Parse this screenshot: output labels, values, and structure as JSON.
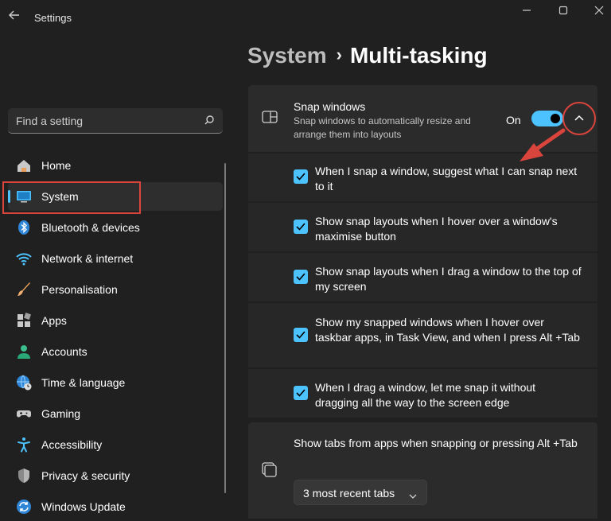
{
  "window": {
    "title": "Settings",
    "icons": {
      "back": "back-arrow-icon",
      "minimize": "minimize-icon",
      "maximize": "maximize-icon",
      "close": "close-icon"
    }
  },
  "breadcrumb": {
    "parent": "System",
    "separator": "›",
    "current": "Multi-tasking"
  },
  "search": {
    "placeholder": "Find a setting",
    "icon": "search-icon"
  },
  "nav": {
    "items": [
      {
        "label": "Home",
        "icon": "home-icon"
      },
      {
        "label": "System",
        "icon": "monitor-icon",
        "active": true
      },
      {
        "label": "Bluetooth & devices",
        "icon": "bluetooth-icon"
      },
      {
        "label": "Network & internet",
        "icon": "wifi-icon"
      },
      {
        "label": "Personalisation",
        "icon": "brush-icon"
      },
      {
        "label": "Apps",
        "icon": "apps-icon"
      },
      {
        "label": "Accounts",
        "icon": "person-icon"
      },
      {
        "label": "Time & language",
        "icon": "globe-clock-icon"
      },
      {
        "label": "Gaming",
        "icon": "gamepad-icon"
      },
      {
        "label": "Accessibility",
        "icon": "accessibility-icon"
      },
      {
        "label": "Privacy & security",
        "icon": "shield-icon"
      },
      {
        "label": "Windows Update",
        "icon": "update-icon"
      }
    ]
  },
  "snap": {
    "title": "Snap windows",
    "description": "Snap windows to automatically resize and arrange them into layouts",
    "toggle_label": "On",
    "toggle_on": true,
    "expanded": true,
    "options": [
      {
        "label": "When I snap a window, suggest what I can snap next to it",
        "checked": true
      },
      {
        "label": "Show snap layouts when I hover over a window's maximise button",
        "checked": true
      },
      {
        "label": "Show snap layouts when I drag a window to the top of my screen",
        "checked": true
      },
      {
        "label": "Show my snapped windows when I hover over taskbar apps, in Task View, and when I press Alt +Tab",
        "checked": true
      },
      {
        "label": "When I drag a window, let me snap it without dragging all the way to the screen edge",
        "checked": true
      }
    ]
  },
  "tabs": {
    "title": "Show tabs from apps when snapping or pressing Alt +Tab",
    "selected": "3 most recent tabs"
  },
  "colors": {
    "accent": "#4cc2ff",
    "annotation": "#d9453c",
    "background": "#202020",
    "card": "#2b2b2b"
  }
}
